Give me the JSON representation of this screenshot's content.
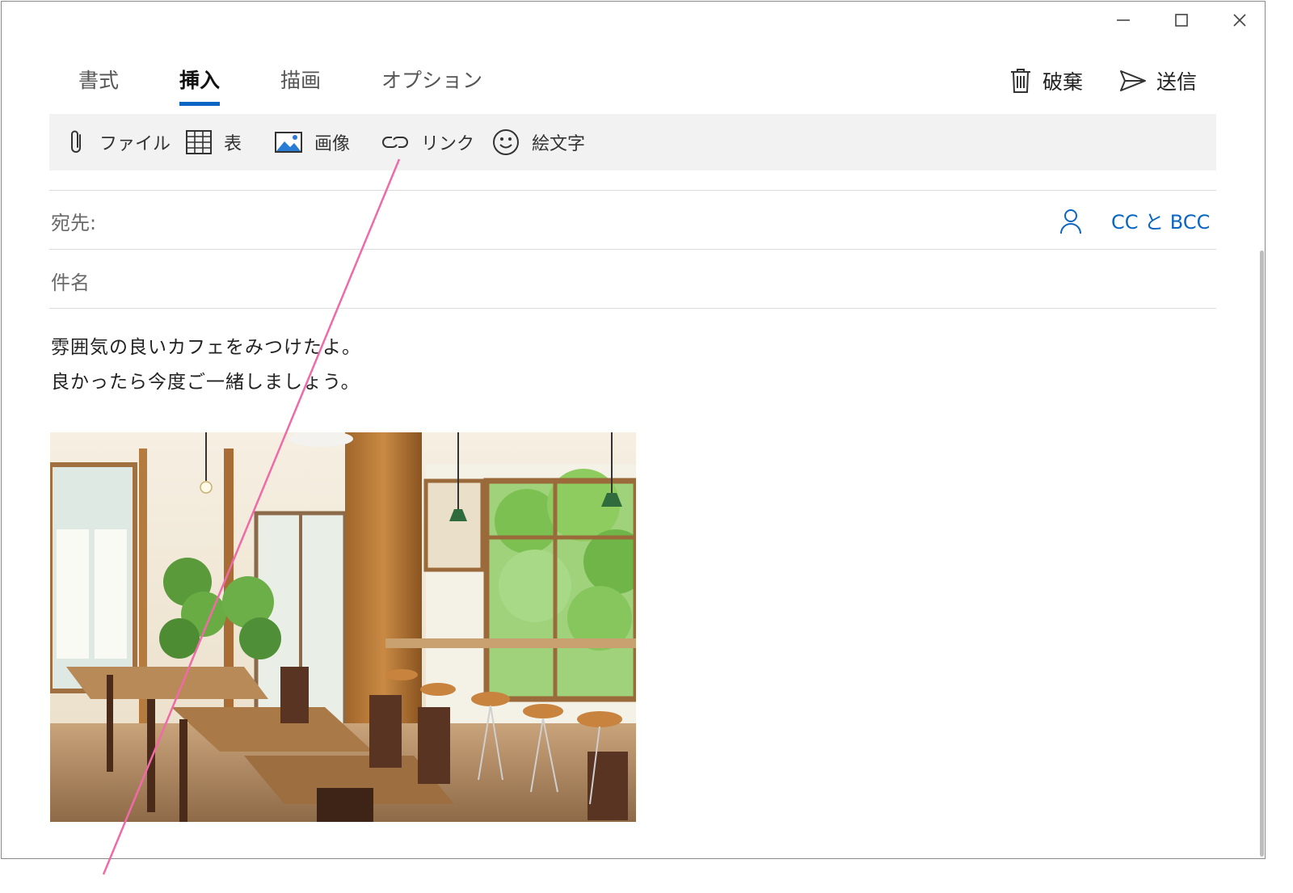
{
  "window": {
    "controls": {
      "minimize_icon": "minimize-icon",
      "maximize_icon": "maximize-icon",
      "close_icon": "close-icon"
    }
  },
  "ribbon": {
    "tabs": [
      {
        "label": "書式",
        "active": false
      },
      {
        "label": "挿入",
        "active": true
      },
      {
        "label": "描画",
        "active": false
      },
      {
        "label": "オプション",
        "active": false
      }
    ],
    "discard_label": "破棄",
    "send_label": "送信"
  },
  "commands": {
    "file": "ファイル",
    "table": "表",
    "image": "画像",
    "link": "リンク",
    "emoji": "絵文字"
  },
  "header": {
    "to_label": "宛先:",
    "subject_label": "件名",
    "cc_bcc_label": "CC と BCC"
  },
  "message": {
    "lines": [
      "雰囲気の良いカフェをみつけたよ。",
      "良かったら今度ご一緒しましょう。"
    ],
    "attachment": "cafe interior photo"
  },
  "colors": {
    "accent": "#0a66c2",
    "annotation": "#f06aa8",
    "commandbar_bg": "#f2f2f2"
  }
}
